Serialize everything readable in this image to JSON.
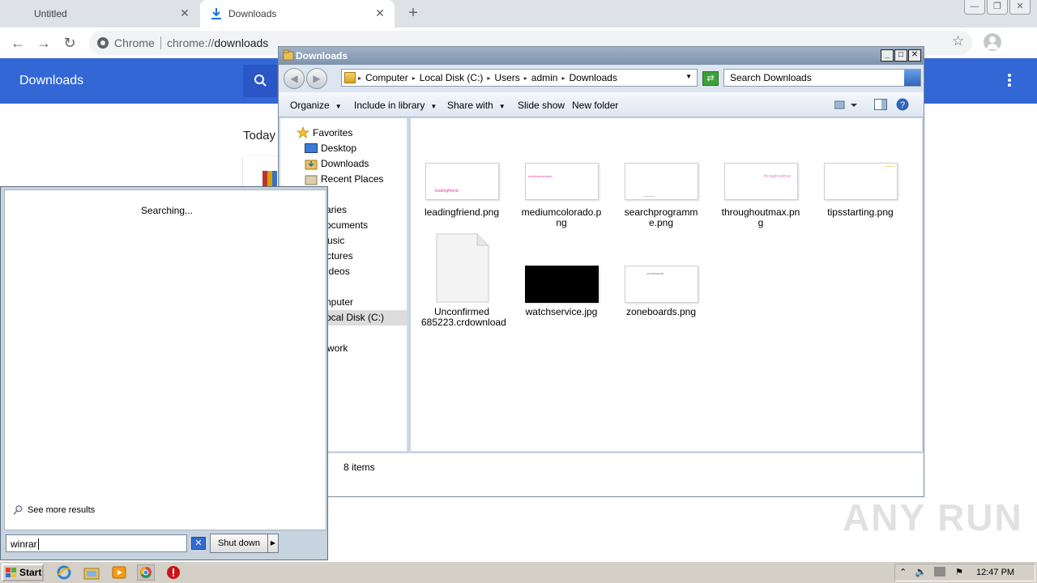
{
  "chrome": {
    "tabs": [
      {
        "label": "Untitled",
        "active": false
      },
      {
        "label": "Downloads",
        "active": true
      }
    ],
    "omnibox": {
      "chip": "Chrome",
      "url_scheme": "chrome://",
      "url_host": "downloads"
    },
    "page": {
      "header_title": "Downloads",
      "section": "Today"
    },
    "colors": {
      "header": "#3367d6",
      "tabstrip": "#dee1e6"
    }
  },
  "explorer": {
    "title": "Downloads",
    "breadcrumb": [
      "Computer",
      "Local Disk (C:)",
      "Users",
      "admin",
      "Downloads"
    ],
    "search_placeholder": "Search Downloads",
    "commands": [
      "Organize",
      "Include in library",
      "Share with",
      "Slide show",
      "New folder"
    ],
    "nav": {
      "favorites_label": "Favorites",
      "favorites": [
        "Desktop",
        "Downloads",
        "Recent Places"
      ],
      "libraries_label": "aries",
      "libraries": [
        "ocuments",
        "usic",
        "ctures",
        "ideos"
      ],
      "computer_label": "nputer",
      "drive_label": "ocal Disk (C:)",
      "network_label": "work"
    },
    "files": [
      {
        "name": "leadingfriend.png",
        "thumb_text": "leadingfriend"
      },
      {
        "name": "mediumcolorado.png",
        "thumb_text": "mediumcolorado"
      },
      {
        "name": "searchprogramme.png",
        "thumb_text": ""
      },
      {
        "name": "throughoutmax.png",
        "thumb_text": "throughoutmax"
      },
      {
        "name": "tipsstarting.png",
        "thumb_text": ""
      },
      {
        "name": "Unconfirmed 685223.crdownload",
        "thumb_text": ""
      },
      {
        "name": "watchservice.jpg",
        "thumb_text": ""
      },
      {
        "name": "zoneboards.png",
        "thumb_text": "zoneboards"
      }
    ],
    "status": "8 items"
  },
  "start_menu": {
    "searching": "Searching...",
    "see_more": "See more results",
    "search_value": "winrar",
    "shutdown_label": "Shut down"
  },
  "taskbar": {
    "start_label": "Start",
    "clock": "12:47 PM"
  },
  "watermark": "ANY RUN"
}
